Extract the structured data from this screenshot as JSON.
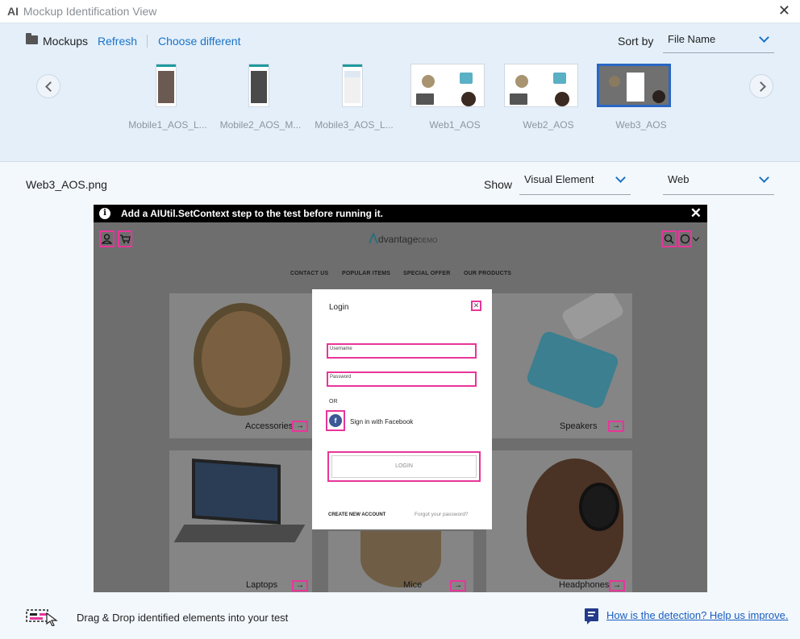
{
  "window": {
    "title_prefix": "AI",
    "title": "Mockup Identification View",
    "close_icon": "close-icon"
  },
  "gallery": {
    "folder_label": "Mockups",
    "refresh": "Refresh",
    "choose_different": "Choose different",
    "sort_label": "Sort by",
    "sort_value": "File Name",
    "thumbnails": [
      {
        "caption": "Mobile1_AOS_L..."
      },
      {
        "caption": "Mobile2_AOS_M..."
      },
      {
        "caption": "Mobile3_AOS_L..."
      },
      {
        "caption": "Web1_AOS"
      },
      {
        "caption": "Web2_AOS"
      },
      {
        "caption": "Web3_AOS",
        "selected": true
      }
    ]
  },
  "viewer": {
    "file_name": "Web3_AOS.png",
    "show_label": "Show",
    "show_value": "Visual Element",
    "platform_value": "Web"
  },
  "banner": {
    "message": "Add a AIUtil.SetContext step to the test before running it."
  },
  "mockup": {
    "logo_main": "dvantage",
    "logo_suffix": "DEMO",
    "menu": [
      "CONTACT US",
      "POPULAR ITEMS",
      "SPECIAL OFFER",
      "OUR PRODUCTS"
    ],
    "tiles": [
      "Accessories",
      "Speakers",
      "Laptops",
      "Mice",
      "Headphones"
    ],
    "arrow": "→",
    "login": {
      "title": "Login",
      "username_placeholder": "Username",
      "password_placeholder": "Password",
      "or": "OR",
      "facebook": "Sign in with Facebook",
      "facebook_letter": "f",
      "button": "LOGIN",
      "create_account": "CREATE NEW ACCOUNT",
      "forgot": "Forgot your password?"
    }
  },
  "footer": {
    "dnd_text": "Drag & Drop identified elements into your test",
    "help_link": "How is the detection? Help us improve."
  },
  "colors": {
    "highlight": "#e8359a",
    "accent": "#1a73c7",
    "banner_bg": "#000000"
  }
}
